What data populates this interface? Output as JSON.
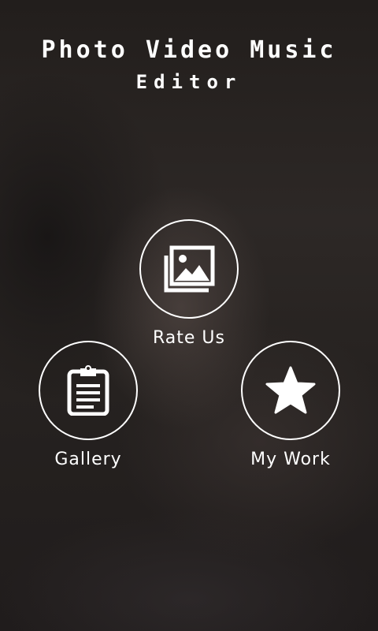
{
  "app": {
    "title_line1": "Photo Video Music",
    "title_line2": "Editor"
  },
  "menu": {
    "rate_us": {
      "label": "Rate Us",
      "icon": "photos-icon"
    },
    "gallery": {
      "label": "Gallery",
      "icon": "clipboard-icon"
    },
    "my_work": {
      "label": "My Work",
      "icon": "star-icon"
    }
  },
  "colors": {
    "foreground": "#ffffff",
    "background": "#2a2523"
  }
}
